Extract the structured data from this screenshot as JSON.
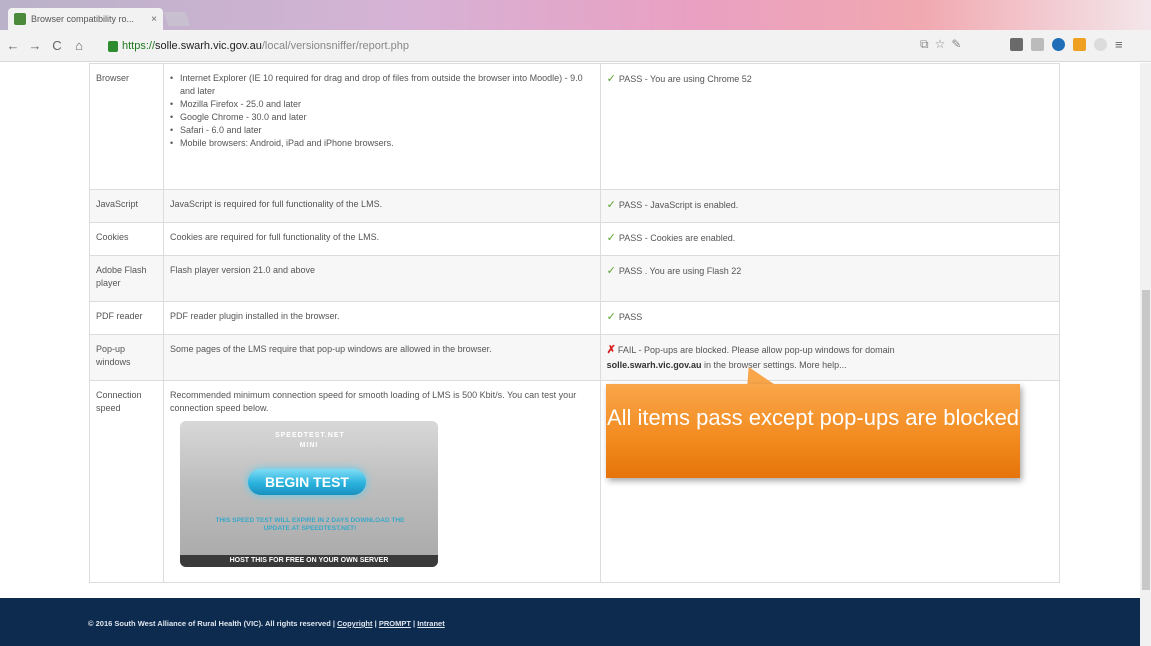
{
  "browser": {
    "tab_title": "Browser compatibility ro...",
    "tab_close": "×",
    "user_badge": "",
    "url_https": "https://",
    "url_host": "solle.swarh.vic.gov.au",
    "url_path": "/local/versionsniffer/report.php",
    "nav_back": "←",
    "nav_forward": "→",
    "nav_reload": "C",
    "nav_home": "⌂",
    "menu_icon": "≡"
  },
  "rows": [
    {
      "label": "Browser",
      "requirements": [
        "Internet Explorer (IE 10 required for drag and drop of files from outside the browser into Moodle) - 9.0 and later",
        "Mozilla Firefox - 25.0 and later",
        "Google Chrome - 30.0 and later",
        "Safari - 6.0 and later",
        "Mobile browsers: Android, iPad and iPhone browsers."
      ],
      "status": "PASS - You are using Chrome 52"
    },
    {
      "label": "JavaScript",
      "requirement": "JavaScript is required for full functionality of the LMS.",
      "status": "PASS - JavaScript is enabled."
    },
    {
      "label": "Cookies",
      "requirement": "Cookies are required for full functionality of the LMS.",
      "status": "PASS - Cookies are enabled."
    },
    {
      "label": "Adobe Flash player",
      "requirement": "Flash player version 21.0 and above",
      "status": "PASS . You are using Flash 22"
    },
    {
      "label": "PDF reader",
      "requirement": "PDF reader plugin installed in the browser.",
      "status": "PASS"
    },
    {
      "label": "Pop-up windows",
      "requirement": "Some pages of the LMS require that pop-up windows are allowed in the browser.",
      "status_prefix": "FAIL - Pop-ups are blocked. Please allow pop-up windows for domain",
      "status_domain": "solle.swarh.vic.gov.au",
      "status_suffix": "in the browser settings.",
      "status_link": "More help..."
    },
    {
      "label": "Connection speed",
      "requirement": "Recommended minimum connection speed for smooth loading of LMS is 500 Kbit/s. You can test your connection speed below."
    }
  ],
  "speedtest": {
    "logo": "SPEEDTEST.NET MINI",
    "begin": "BEGIN TEST",
    "note": "THIS SPEED TEST WILL EXPIRE IN 2 DAYS DOWNLOAD THE UPDATE AT SPEEDTEST.NET!",
    "host": "HOST THIS FOR FREE ON YOUR OWN SERVER"
  },
  "callout": {
    "text": "All items pass except pop-ups are blocked"
  },
  "footer": {
    "copyright": "© 2016 South West Alliance of Rural Health (VIC). All rights reserved |",
    "link_copyright": "Copyright",
    "sep1": "|",
    "link_prompt": "PROMPT",
    "sep2": "|",
    "link_intranet": "Intranet"
  },
  "colors": {
    "footer_bg": "#0d2b4e",
    "pass": "#5aa02c",
    "fail": "#d62020",
    "callout": "#f28a1e"
  }
}
